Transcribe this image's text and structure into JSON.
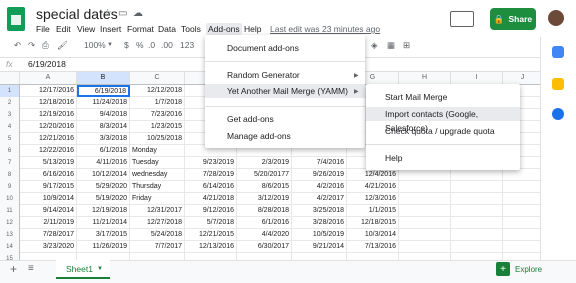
{
  "title": "special dates",
  "menu": [
    "File",
    "Edit",
    "View",
    "Insert",
    "Format",
    "Data",
    "Tools",
    "Add-ons",
    "Help"
  ],
  "last_edit": "Last edit was 23 minutes ago",
  "share_label": "Share",
  "toolbar": {
    "zoom": "100%",
    "currency": "$",
    "percent": "%",
    "dec0": ".0",
    "dec00": ".00",
    "numfmt": "123"
  },
  "fx": {
    "label": "fx",
    "content": "6/19/2018"
  },
  "columns": [
    "A",
    "B",
    "C",
    "D",
    "E",
    "F",
    "G",
    "H",
    "I",
    "J"
  ],
  "rows": [
    {
      "n": "1",
      "c": [
        "12/17/2016",
        "6/19/2018",
        "12/12/2018",
        "",
        "",
        "",
        "",
        "",
        ""
      ]
    },
    {
      "n": "2",
      "c": [
        "12/18/2016",
        "11/24/2018",
        "1/7/2018",
        "",
        "",
        "",
        "",
        "",
        ""
      ]
    },
    {
      "n": "3",
      "c": [
        "12/19/2016",
        "9/4/2018",
        "7/23/2016",
        "",
        "",
        "",
        "",
        "",
        ""
      ]
    },
    {
      "n": "4",
      "c": [
        "12/20/2016",
        "8/3/2014",
        "1/23/2015",
        "",
        "",
        "",
        "",
        "",
        ""
      ]
    },
    {
      "n": "5",
      "c": [
        "12/21/2016",
        "3/3/2018",
        "10/25/2018",
        "",
        "",
        "",
        "",
        "",
        ""
      ]
    },
    {
      "n": "6",
      "c": [
        "12/22/2016",
        "6/1/2018",
        "Monday",
        "",
        "",
        "",
        "",
        "",
        ""
      ]
    },
    {
      "n": "7",
      "c": [
        "5/13/2019",
        "4/11/2016",
        "Tuesday",
        "9/23/2019",
        "2/3/2019",
        "7/4/2016",
        "",
        "",
        ""
      ]
    },
    {
      "n": "8",
      "c": [
        "6/16/2016",
        "10/12/2014",
        "wednesday",
        "7/28/2019",
        "5/20/20177",
        "9/26/2019",
        "12/4/2016",
        "",
        ""
      ]
    },
    {
      "n": "9",
      "c": [
        "9/17/2015",
        "5/29/2020",
        "Thursday",
        "6/14/2016",
        "8/6/2015",
        "4/2/2016",
        "4/21/2016",
        "",
        ""
      ]
    },
    {
      "n": "10",
      "c": [
        "10/9/2014",
        "5/19/2020",
        "Friday",
        "4/21/2018",
        "3/12/2019",
        "4/2/2017",
        "12/3/2016",
        "",
        ""
      ]
    },
    {
      "n": "11",
      "c": [
        "9/14/2014",
        "12/19/2018",
        "12/31/2017",
        "9/12/2016",
        "8/28/2018",
        "3/25/2018",
        "1/1/2015",
        "",
        ""
      ]
    },
    {
      "n": "12",
      "c": [
        "2/11/2019",
        "11/21/2014",
        "12/27/2018",
        "5/7/2018",
        "6/1/2016",
        "3/28/2016",
        "12/18/2015",
        "",
        ""
      ]
    },
    {
      "n": "13",
      "c": [
        "7/28/2017",
        "3/17/2015",
        "5/24/2018",
        "12/21/2015",
        "4/4/2020",
        "10/5/2019",
        "10/3/2014",
        "",
        ""
      ]
    },
    {
      "n": "14",
      "c": [
        "3/23/2020",
        "11/26/2019",
        "7/7/2017",
        "12/13/2016",
        "6/30/2017",
        "9/21/2014",
        "7/13/2016",
        "",
        ""
      ]
    },
    {
      "n": "15",
      "c": [
        "",
        "",
        "",
        "",
        "",
        "",
        "",
        "",
        ""
      ]
    }
  ],
  "addons_menu": {
    "items": [
      "Document add-ons",
      "Random Generator",
      "Yet Another Mail Merge (YAMM)",
      "Get add-ons",
      "Manage add-ons"
    ]
  },
  "yamm_menu": {
    "items": [
      "Start Mail Merge",
      "Import contacts (Google, Salesforce)",
      "Check quota / upgrade quota",
      "Help"
    ]
  },
  "sheet_tab": "Sheet1",
  "explore_label": "Explore",
  "colors": {
    "accent": "#1a73e8",
    "green": "#188038",
    "share": "#1e8e3e"
  }
}
